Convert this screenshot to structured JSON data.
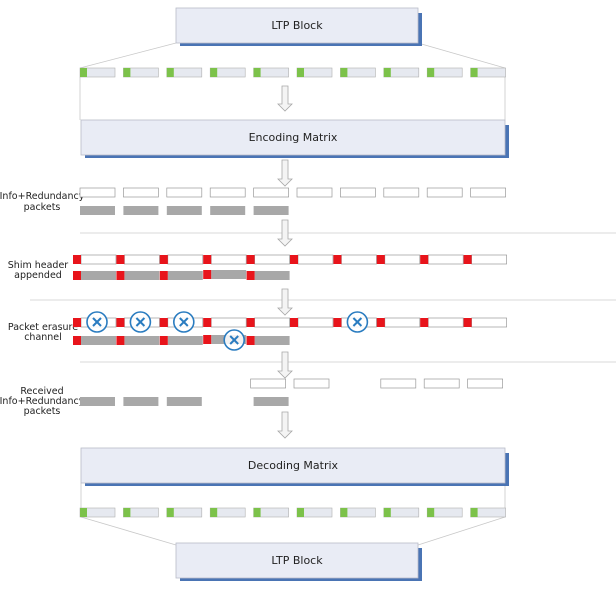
{
  "colors": {
    "box_fill": "#e9ecf5",
    "box_shadow": "#4a74b4",
    "packet_fill": "#e6e9f0",
    "header_green": "#7cc24a",
    "shim_red": "#e8141b",
    "redundancy_gray": "#a8a8a8",
    "erasure_blue": "#2a7cc0",
    "separator": "#e6e6e6"
  },
  "top_block": {
    "label": "LTP Block"
  },
  "encoding": {
    "label": "Encoding Matrix"
  },
  "decoding": {
    "label": "Decoding Matrix"
  },
  "bottom_block": {
    "label": "LTP Block"
  },
  "rows": {
    "info_redundancy": {
      "label_line1": "Info+Redundancy",
      "label_line2": "packets",
      "info_present": [
        1,
        2,
        3,
        4,
        5,
        6,
        7,
        8,
        9,
        10
      ],
      "redundancy_present": [
        1,
        2,
        3,
        4,
        5
      ]
    },
    "shim": {
      "label_line1": "Shim header",
      "label_line2": "appended"
    },
    "erasure": {
      "label_line1": "Packet erasure",
      "label_line2": "channel",
      "erased_info": [
        1,
        2,
        3,
        7
      ],
      "erased_redundancy": [
        4
      ]
    },
    "received": {
      "label_line1": "Received",
      "label_line2": "Info+Redundancy",
      "label_line3": "packets",
      "info_present": [
        5,
        6,
        8,
        9,
        10
      ],
      "redundancy_present": [
        1,
        2,
        3,
        5
      ]
    }
  },
  "icons": {
    "arrow": "arrow-down-icon",
    "erasure": "x-circle-icon"
  }
}
